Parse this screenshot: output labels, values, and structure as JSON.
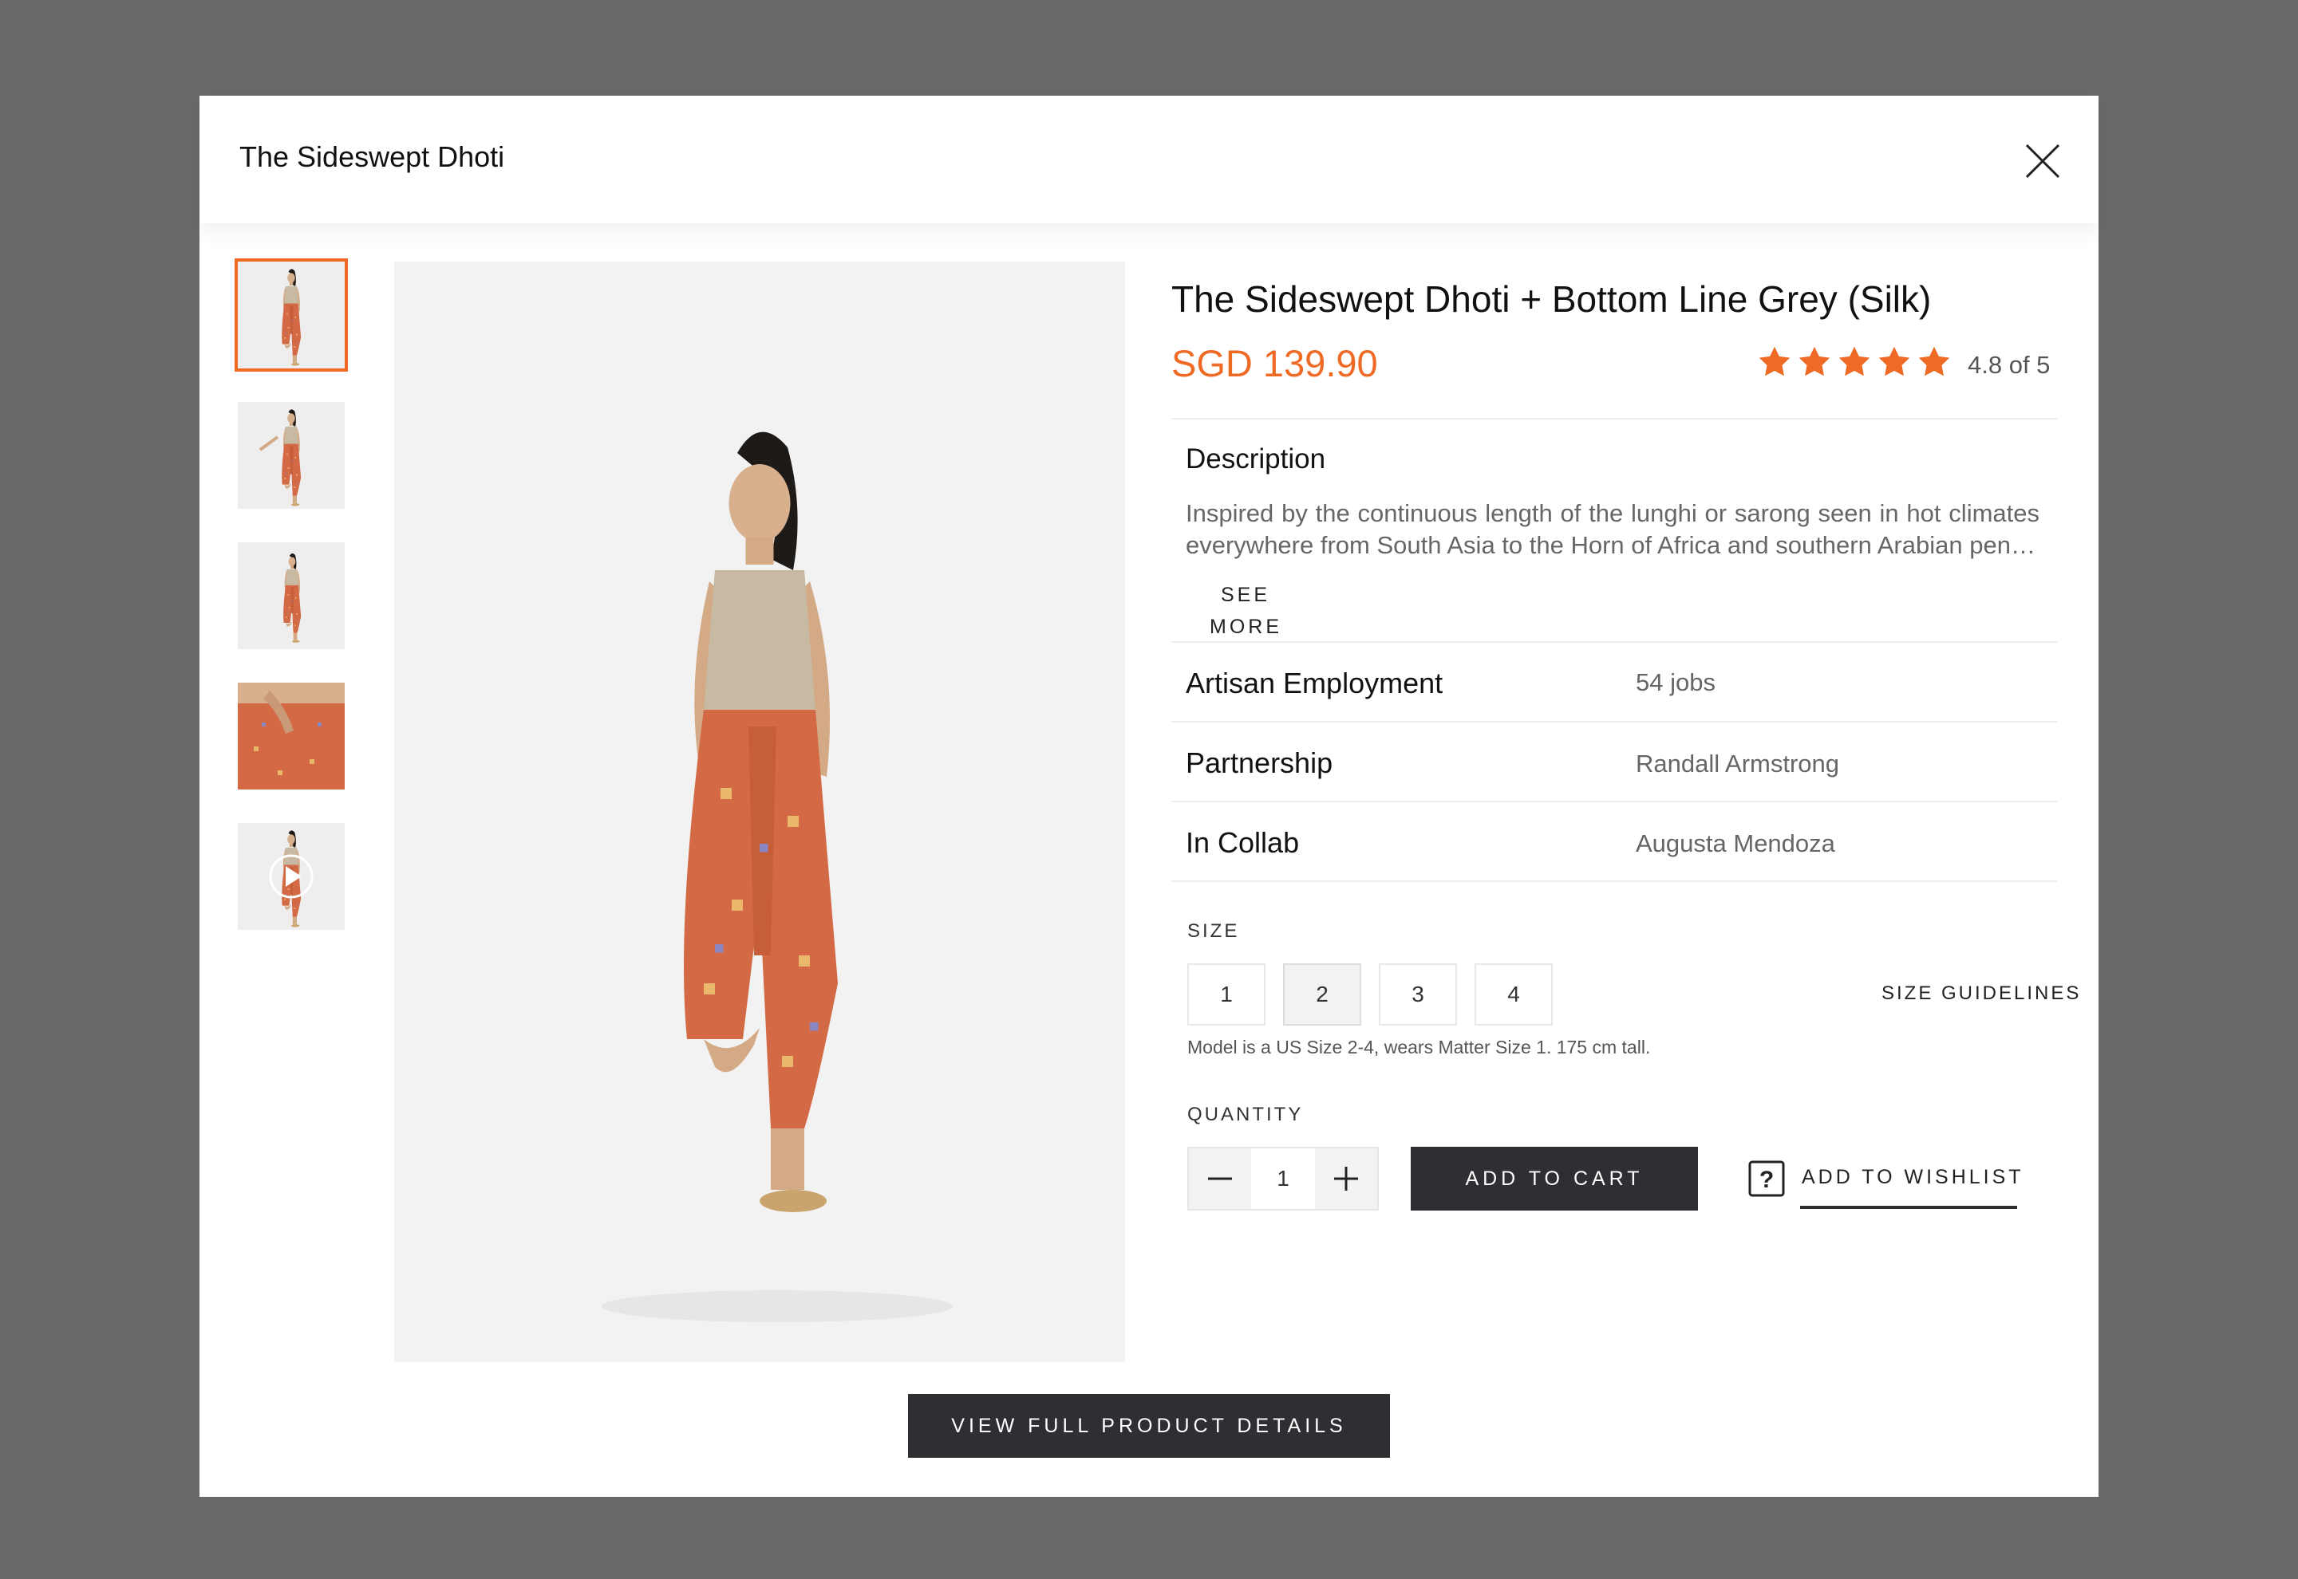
{
  "modal": {
    "title": "The Sideswept Dhoti"
  },
  "gallery": {
    "thumbnails": [
      {
        "view": "front",
        "active": true
      },
      {
        "view": "side-arm-raised",
        "active": false
      },
      {
        "view": "side",
        "active": false
      },
      {
        "view": "fabric-detail",
        "active": false
      },
      {
        "view": "video",
        "active": false
      }
    ]
  },
  "product": {
    "name": "The Sideswept Dhoti + Bottom Line Grey (Silk)",
    "price": "SGD 139.90",
    "rating": {
      "stars": 5,
      "text": "4.8 of 5"
    },
    "description": {
      "heading": "Description",
      "text": "Inspired by the continuous length of the lunghi or sarong seen in hot climates everywhere from South Asia to the Horn of Africa and southern Arabian pen…",
      "see_more": "SEE MORE"
    },
    "attributes": [
      {
        "label": "Artisan Employment",
        "value": "54 jobs"
      },
      {
        "label": "Partnership",
        "value": "Randall Armstrong"
      },
      {
        "label": "In Collab",
        "value": "Augusta Mendoza"
      }
    ],
    "size": {
      "label": "SIZE",
      "options": [
        "1",
        "2",
        "3",
        "4"
      ],
      "selected": "2",
      "guidelines": "SIZE GUIDELINES",
      "note": "Model is a US Size 2-4, wears Matter Size 1. 175 cm tall."
    },
    "quantity": {
      "label": "QUANTITY",
      "value": "1"
    },
    "add_to_cart": "ADD TO CART",
    "add_to_wishlist": "ADD TO WISHLIST",
    "view_full": "VIEW FULL PRODUCT DETAILS"
  },
  "colors": {
    "accent": "#ee6a25",
    "dark_button": "#2d2f33",
    "overlay": "#696969"
  }
}
